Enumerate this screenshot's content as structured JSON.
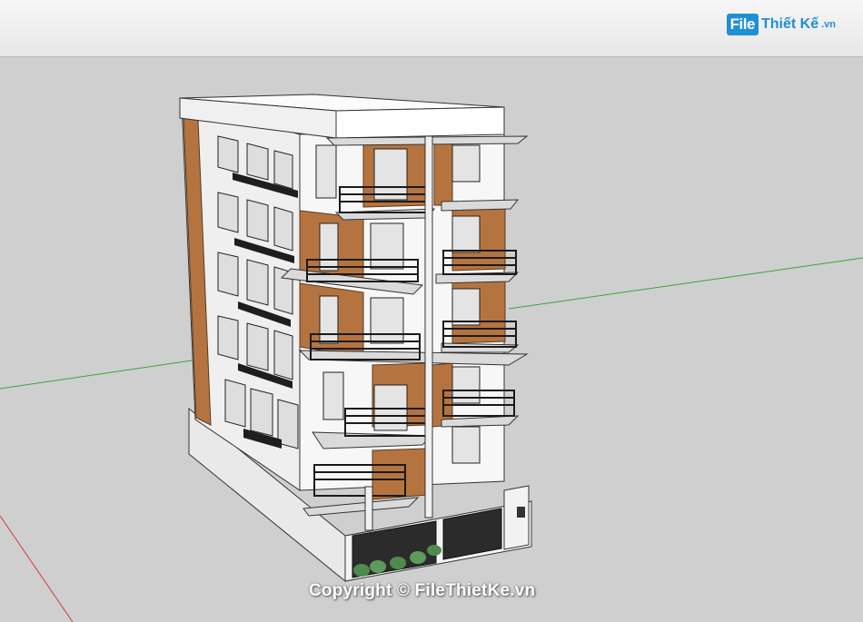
{
  "toolbar": {
    "brand_mark": "File",
    "brand_name": "Thiết Kế",
    "brand_ext": ".vn"
  },
  "viewport": {
    "watermark": "Copyright © FileThietKe.vn",
    "axis_colors": {
      "green": "#3aa53a",
      "red": "#d03a3a"
    },
    "model": "building-model"
  }
}
